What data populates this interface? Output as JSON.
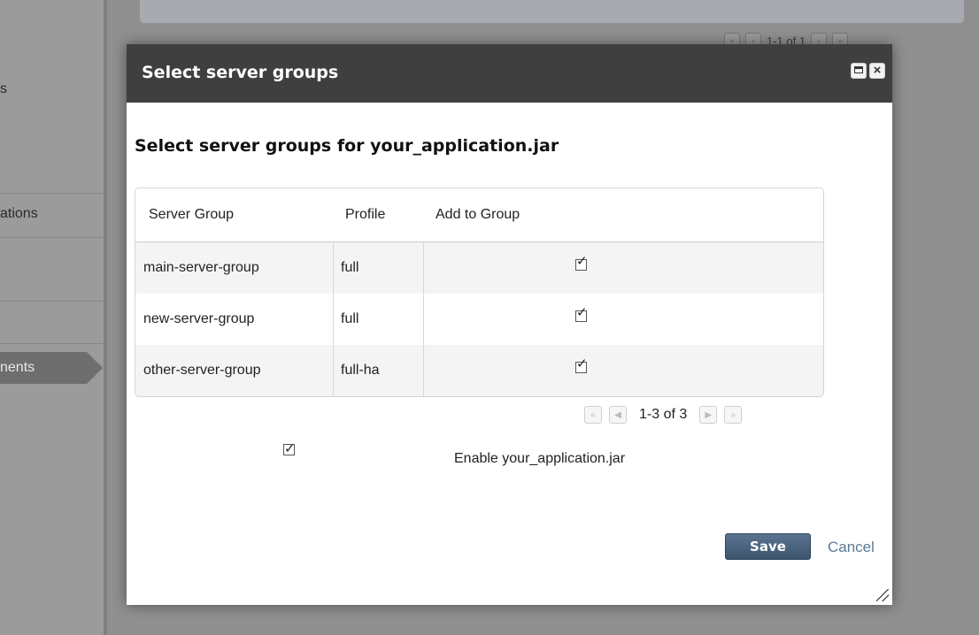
{
  "background": {
    "sidebar_items": [
      "s",
      "ations",
      "nents"
    ],
    "pager_text": "1-1 of 1"
  },
  "dialog": {
    "title": "Select server groups",
    "subtitle": "Select server groups for your_application.jar",
    "table": {
      "headers": [
        "Server Group",
        "Profile",
        "Add to Group"
      ],
      "rows": [
        {
          "group": "main-server-group",
          "profile": "full",
          "checked": true
        },
        {
          "group": "new-server-group",
          "profile": "full",
          "checked": true
        },
        {
          "group": "other-server-group",
          "profile": "full-ha",
          "checked": true
        }
      ]
    },
    "pager": {
      "text": "1-3 of 3"
    },
    "enable": {
      "label": "Enable your_application.jar",
      "checked": true
    },
    "buttons": {
      "save": "Save",
      "cancel": "Cancel"
    }
  },
  "icons": {
    "maximize": "maximize-icon",
    "close": "close-icon",
    "check": "checkmark-icon"
  }
}
